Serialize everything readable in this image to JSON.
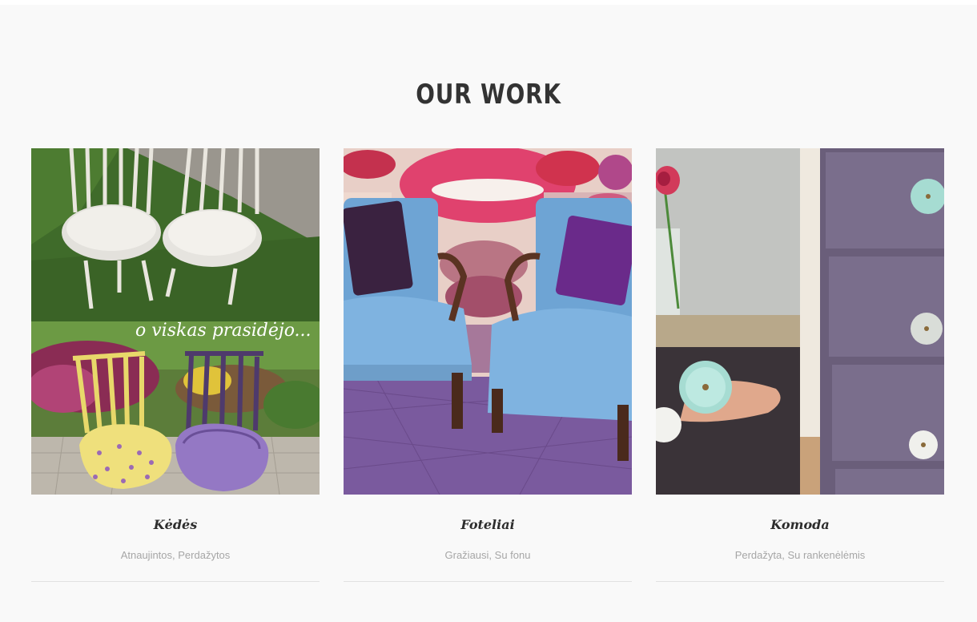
{
  "section": {
    "title": "OUR WORK"
  },
  "cards": [
    {
      "title": "Kėdės",
      "tags": "Atnaujintos, Perdažytos",
      "image_caption": "o viskas prasidėjo..."
    },
    {
      "title": "Foteliai",
      "tags": "Gražiausi, Su fonu"
    },
    {
      "title": "Komoda",
      "tags": "Perdažyta, Su rankenėlėmis"
    }
  ],
  "colors": {
    "background": "#f9f9f9",
    "heading": "#333333",
    "tags": "#a6a6a6",
    "divider": "#e2e2e2"
  }
}
